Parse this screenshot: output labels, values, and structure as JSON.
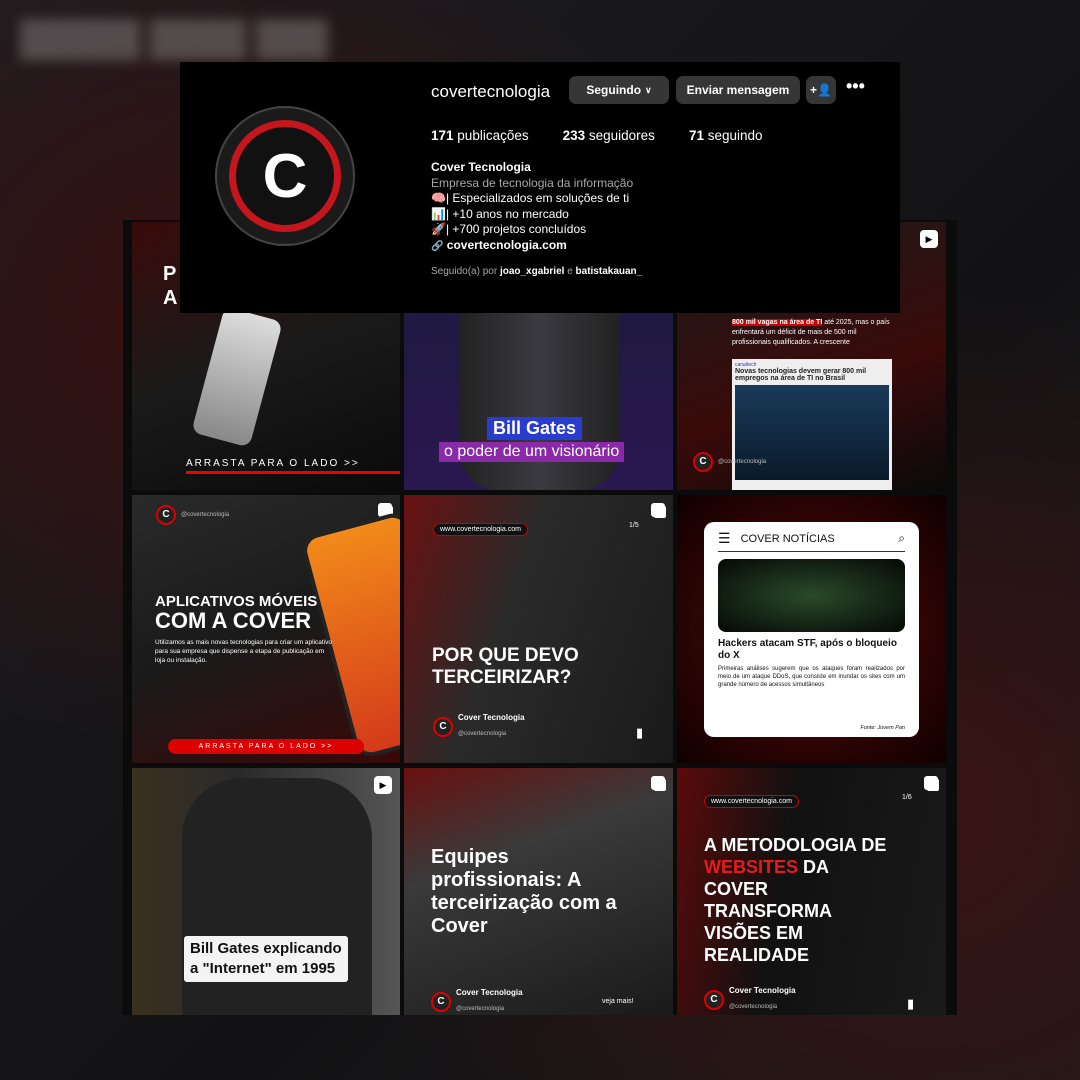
{
  "profile": {
    "username": "covertecnologia",
    "follow_button": "Seguindo",
    "message_button": "Enviar mensagem",
    "add_user_icon": "person-plus-icon",
    "more_icon": "ellipsis-icon",
    "stats": {
      "posts_count": "171",
      "posts_label": "publicações",
      "followers_count": "233",
      "followers_label": "seguidores",
      "following_count": "71",
      "following_label": "seguindo"
    },
    "name": "Cover Tecnologia",
    "category": "Empresa de tecnologia da informação",
    "bio_lines": [
      "🧠| Especializados em soluções de ti",
      "📊| +10 anos no mercado",
      "🚀| +700 projetos concluídos"
    ],
    "link": "covertecnologia.com",
    "followed_by_prefix": "Seguido(a) por",
    "followed_by_1": "joao_xgabriel",
    "followed_by_and": "e",
    "followed_by_2": "batistakauan_"
  },
  "posts": {
    "p1": {
      "title_fragment": "P A",
      "cta": "ARRASTA PARA O LADO >>"
    },
    "p2": {
      "line1": "Bill Gates",
      "line2": "o poder de um visionário",
      "icon": "reel-icon"
    },
    "p3": {
      "highlight": "800 mil vagas na área de TI",
      "text": " até 2025, mas o país enfrentará um déficit de mais de 500 mil profissionais qualificados. A crescente",
      "card_tag": "canaltech",
      "card_title": "Novas tecnologias devem gerar 800 mil empregos na área de TI no Brasil",
      "handle": "@covertecnologia",
      "icon": "reel-icon"
    },
    "p4": {
      "handle": "@covertecnologia",
      "title1": "APLICATIVOS MÓVEIS",
      "title2": "COM A COVER",
      "body": "Utilizamos as mais novas tecnologias para criar um aplicativo para sua empresa que dispense a etapa de publicação em loja ou instalação.",
      "cta": "ARRASTA PARA O LADO >>",
      "icon": "carousel-icon"
    },
    "p5": {
      "url": "www.covertecnologia.com",
      "page": "1/5",
      "title": "POR QUE DEVO TERCEIRIZAR?",
      "brand": "Cover Tecnologia",
      "handle": "@covertecnologia",
      "icon": "carousel-icon"
    },
    "p6": {
      "header": "COVER NOTÍCIAS",
      "headline": "Hackers atacam STF, após o bloqueio do X",
      "body": "Primeiras análises sugerem que os ataques foram realizados por meio de um ataque DDoS, que consiste em inundar os sites com um grande número de acessos simultâneos",
      "source": "Fonte: Jovem Pan"
    },
    "p7": {
      "caption1": "Bill Gates explicando",
      "caption2": "a \"Internet\" em 1995",
      "icon": "reel-icon"
    },
    "p8": {
      "title": "Equipes profissionais: A terceirização com a Cover",
      "brand": "Cover Tecnologia",
      "handle": "@covertecnologia",
      "more": "veja mais!",
      "icon": "carousel-icon"
    },
    "p9": {
      "url": "www.covertecnologia.com",
      "page": "1/6",
      "title_a": "A METODOLOGIA DE ",
      "title_red": "WEBSITES",
      "title_b": " DA COVER TRANSFORMA VISÕES EM REALIDADE",
      "brand": "Cover Tecnologia",
      "handle": "@covertecnologia",
      "icon": "carousel-icon"
    }
  },
  "colors": {
    "accent": "#d4161c",
    "button": "#363636",
    "background": "#000000"
  }
}
